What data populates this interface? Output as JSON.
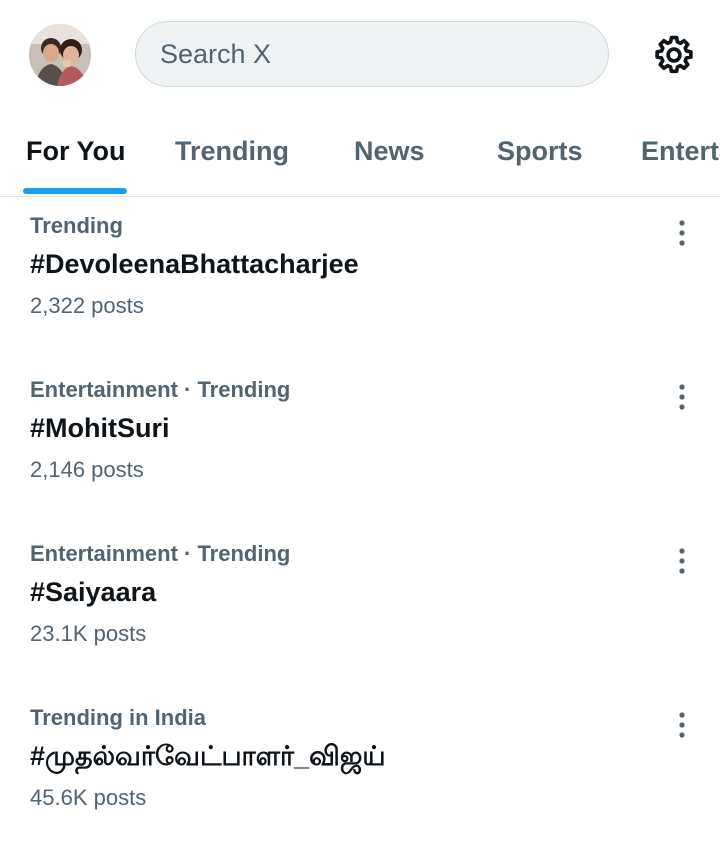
{
  "header": {
    "avatar_icon": "profile-avatar",
    "search_placeholder": "Search X",
    "settings_icon": "gear-icon"
  },
  "tabs": [
    {
      "label": "For You",
      "active": true
    },
    {
      "label": "Trending",
      "active": false
    },
    {
      "label": "News",
      "active": false
    },
    {
      "label": "Sports",
      "active": false
    },
    {
      "label": "Entertainment",
      "active": false
    }
  ],
  "trends": [
    {
      "meta": "Trending",
      "title": "#DevoleenaBhattacharjee",
      "count": "2,322 posts"
    },
    {
      "meta": "Entertainment · Trending",
      "title": "#MohitSuri",
      "count": "2,146 posts"
    },
    {
      "meta": "Entertainment · Trending",
      "title": "#Saiyaara",
      "count": "23.1K posts"
    },
    {
      "meta": "Trending in India",
      "title": "#முதல்வர்வேட்பாளர்_விஜய்",
      "count": "45.6K posts"
    }
  ],
  "colors": {
    "accent": "#1d9bf0",
    "text_primary": "#0f1419",
    "text_secondary": "#536471",
    "search_bg": "#eff3f4"
  }
}
